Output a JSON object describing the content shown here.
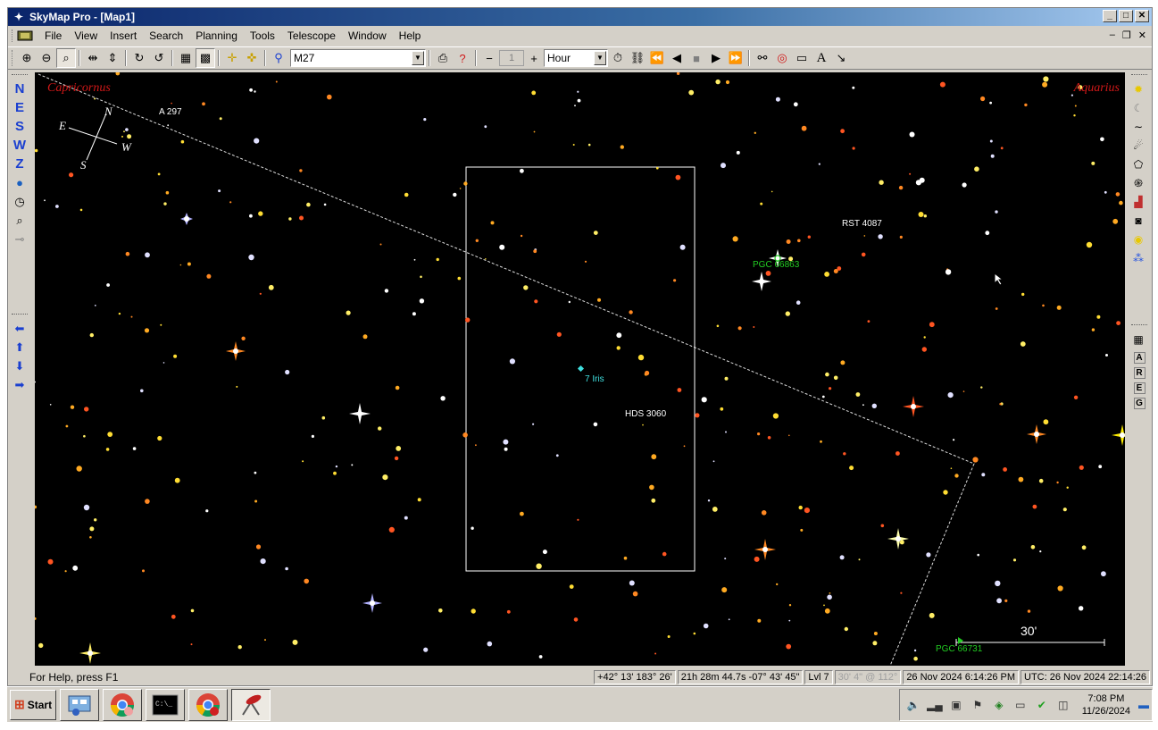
{
  "window": {
    "title": "SkyMap Pro - [Map1]",
    "controls": [
      "_",
      "□",
      "✕"
    ]
  },
  "menu": {
    "items": [
      "File",
      "View",
      "Insert",
      "Search",
      "Planning",
      "Tools",
      "Telescope",
      "Window",
      "Help"
    ]
  },
  "toolbar": {
    "search_value": "M27",
    "step_value": "1",
    "time_unit": "Hour"
  },
  "left_tools": {
    "directions": [
      "N",
      "E",
      "S",
      "W",
      "Z"
    ]
  },
  "map": {
    "constellations": {
      "left": "Capricornus",
      "right": "Aquarius"
    },
    "compass": {
      "n": "N",
      "e": "E",
      "s": "S",
      "w": "W"
    },
    "labels": {
      "a297": "A 297",
      "rst4087": "RST 4087",
      "pgc66863": "PGC 66863",
      "iris": "7 Iris",
      "hds3060": "HDS 3060",
      "pgc66731": "PGC 66731"
    },
    "scale_label": "30'"
  },
  "status": {
    "help": "For Help, press F1",
    "altaz": "+42° 13'  183° 26'",
    "radec": "21h 28m 44.7s  -07° 43' 45\"",
    "level": "Lvl 7",
    "fov": "30' 4\" @ 112°",
    "local_time": "26 Nov 2024 6:14:26 PM",
    "utc_time": "UTC: 26 Nov 2024 22:14:26"
  },
  "taskbar": {
    "start": "Start",
    "time": "7:08 PM",
    "date": "11/26/2024"
  },
  "colors": {
    "title_start": "#0a246a",
    "title_end": "#a6caf0",
    "constellation": "#d01818",
    "galaxy_label": "#22cc22",
    "minor_planet": "#40e0e0"
  }
}
